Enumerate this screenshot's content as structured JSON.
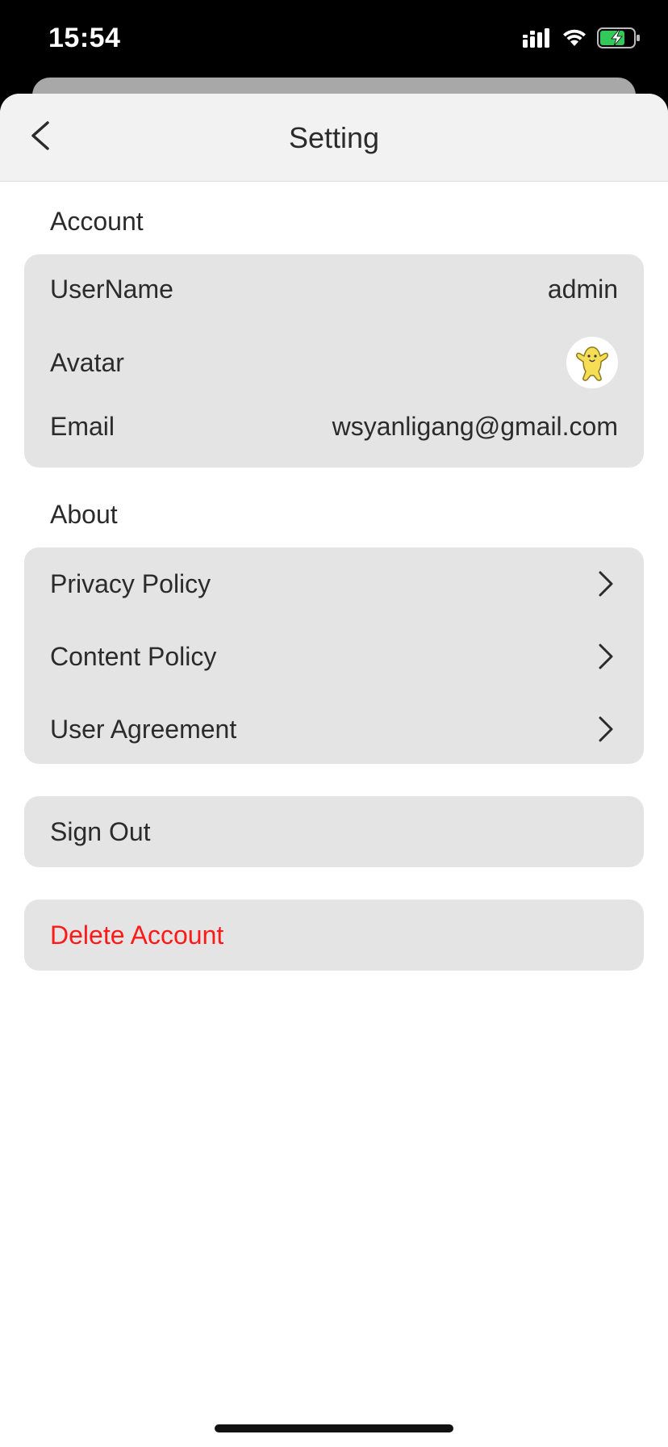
{
  "status_bar": {
    "time": "15:54",
    "icons": [
      "cellular-signal-icon",
      "wifi-icon",
      "battery-charging-icon"
    ]
  },
  "nav": {
    "title": "Setting",
    "back_icon": "chevron-left-icon"
  },
  "account": {
    "header": "Account",
    "rows": [
      {
        "label": "UserName",
        "value": "admin"
      },
      {
        "label": "Avatar",
        "value_icon": "avatar-icon"
      },
      {
        "label": "Email",
        "value": "wsyanligang@gmail.com"
      }
    ]
  },
  "about": {
    "header": "About",
    "rows": [
      {
        "label": "Privacy Policy",
        "icon": "chevron-right-icon"
      },
      {
        "label": "Content Policy",
        "icon": "chevron-right-icon"
      },
      {
        "label": "User Agreement",
        "icon": "chevron-right-icon"
      }
    ]
  },
  "actions": {
    "sign_out": "Sign Out",
    "delete_account": "Delete Account"
  },
  "colors": {
    "card_background": "#e4e4e4",
    "nav_background": "#f2f2f2",
    "danger": "#ff1a1a",
    "battery_green": "#34c759"
  }
}
